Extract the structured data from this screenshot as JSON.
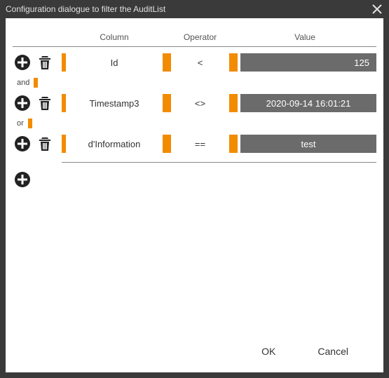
{
  "window": {
    "title": "Configuration dialogue to filter the AuditList"
  },
  "colors": {
    "accent": "#f38b00",
    "valueBg": "#6b6b6b"
  },
  "headers": {
    "column": "Column",
    "operator": "Operator",
    "value": "Value"
  },
  "rows": [
    {
      "column": "Id",
      "operator": "<",
      "value": "125",
      "align": "right",
      "conj_after": "and"
    },
    {
      "column": "Timestamp3",
      "operator": "<>",
      "value": "2020-09-14 16:01:21",
      "align": "center",
      "conj_after": "or"
    },
    {
      "column": "d'Information",
      "operator": "==",
      "value": "test",
      "align": "center",
      "conj_after": null
    }
  ],
  "footer": {
    "ok": "OK",
    "cancel": "Cancel"
  }
}
